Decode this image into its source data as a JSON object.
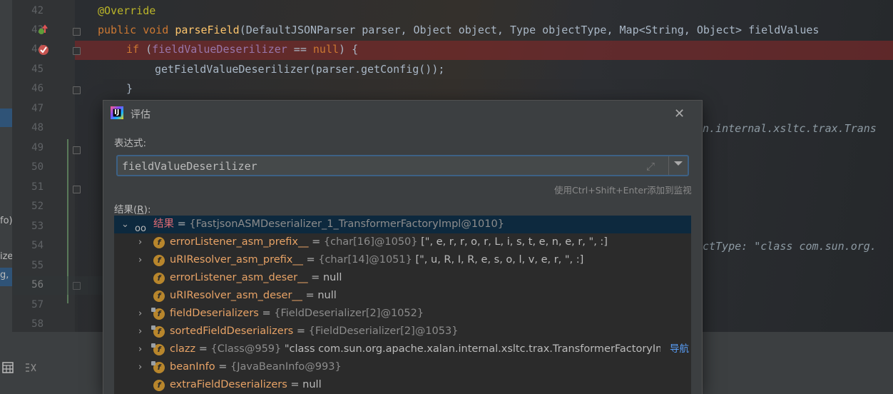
{
  "left_strip": {
    "items": [
      "fo)",
      "izer",
      "g,"
    ]
  },
  "line_numbers": [
    "42",
    "43",
    "44",
    "45",
    "46",
    "47",
    "48",
    "49",
    "50",
    "51",
    "52",
    "53",
    "54",
    "55",
    "56",
    "57",
    "58"
  ],
  "code": {
    "l42": "@Override",
    "l43_kw1": "public void ",
    "l43_fn": "parseField",
    "l43_rest": "(DefaultJSONParser parser, Object object, Type objectType, Map<String, Object> fieldValues",
    "l44_if": "if ",
    "l44_paren": "(",
    "l44_field": "fieldValueDeserilizer",
    "l44_op": " == ",
    "l44_null": "null",
    "l44_end": ") {",
    "l45": "getFieldValueDeserilizer(parser.getConfig());",
    "l45_semi": ";",
    "l46": "}"
  },
  "background_text": {
    "line48": "n.internal.xsltc.trax.Trans",
    "line54": "ctType: \"class com.sun.org."
  },
  "dialog": {
    "title": "评估",
    "expression_label": "表达式:",
    "expression_value": "fieldValueDeserilizer",
    "hint": "使用Ctrl+Shift+Enter添加到监视",
    "result_label": "结果(",
    "result_key": "R",
    "result_label_end": "):",
    "rows": [
      {
        "name": "结果",
        "eq": " = ",
        "type": "{FastjsonASMDeserializer_1_TransformerFactoryImpl@1010}",
        "value": ""
      },
      {
        "name": "errorListener_asm_prefix__",
        "eq": " = ",
        "type": "{char[16]@1050}",
        "value": " [\", e, r, r, o, r, L, i, s, t, e, n, e, r, \", :]"
      },
      {
        "name": "uRIResolver_asm_prefix__",
        "eq": " = ",
        "type": "{char[14]@1051}",
        "value": " [\", u, R, I, R, e, s, o, l, v, e, r, \", :]"
      },
      {
        "name": "errorListener_asm_deser__",
        "eq": " = ",
        "type": "",
        "value": "null"
      },
      {
        "name": "uRIResolver_asm_deser__",
        "eq": " = ",
        "type": "",
        "value": "null"
      },
      {
        "name": "fieldDeserializers",
        "eq": " = ",
        "type": "{FieldDeserializer[2]@1052}",
        "value": ""
      },
      {
        "name": "sortedFieldDeserializers",
        "eq": " = ",
        "type": "{FieldDeserializer[2]@1053}",
        "value": ""
      },
      {
        "name": "clazz",
        "eq": " = ",
        "type": "{Class@959}",
        "value": " \"class com.sun.org.apache.xalan.internal.xsltc.trax.TransformerFactoryImpl..."
      },
      {
        "name": "beanInfo",
        "eq": " = ",
        "type": "{JavaBeanInfo@993}",
        "value": ""
      },
      {
        "name": "extraFieldDeserializers",
        "eq": " = ",
        "type": "",
        "value": "null"
      }
    ],
    "navigate_link": "导航"
  },
  "colors": {
    "accent": "#3d6185",
    "selection": "#0d293e",
    "breakpoint": "#c75450"
  }
}
